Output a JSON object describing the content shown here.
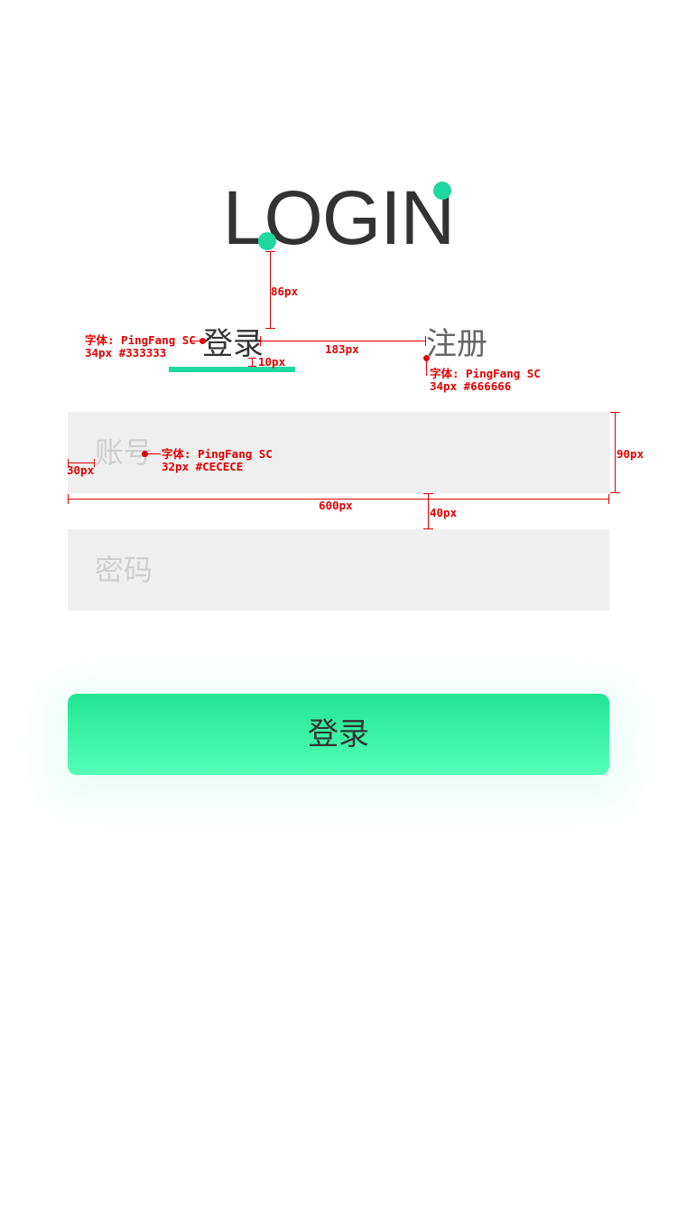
{
  "header": {
    "title": "LOGIN"
  },
  "tabs": [
    {
      "label": "登录",
      "active": true
    },
    {
      "label": "注册",
      "active": false
    }
  ],
  "form": {
    "account_placeholder": "账号",
    "account_value": "",
    "password_placeholder": "密码",
    "password_value": "",
    "submit_label": "登录"
  },
  "annotations": {
    "height_86": "86px",
    "gap_183": "183px",
    "gap_10": "10px",
    "login_font_name": "字体: PingFang SC",
    "login_font_spec": "34px #333333",
    "register_font_name": "字体: PingFang SC",
    "register_font_spec": "34px #666666",
    "input_font_name": "字体: PingFang SC",
    "input_font_spec": "32px #CECECE",
    "padding_30": "30px",
    "height_90": "90px",
    "width_600": "600px",
    "gap_40": "40px"
  },
  "colors": {
    "accent": "#1fd8a0",
    "title_text": "#333333",
    "active_tab_text": "#333333",
    "inactive_tab_text": "#666666",
    "placeholder_text": "#CECECE",
    "input_background": "#efefef",
    "button_gradient_top": "#22e693",
    "button_gradient_bottom": "#52ffb6",
    "annotation": "#e00000"
  }
}
